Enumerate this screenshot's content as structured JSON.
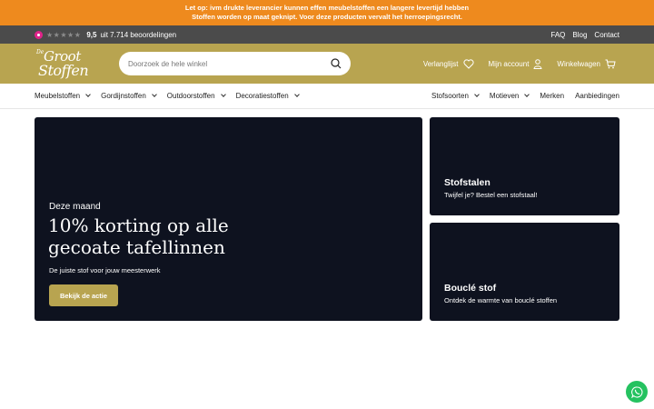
{
  "announcement": {
    "line1": "Let op: ivm drukte leverancier kunnen effen meubelstoffen een langere levertijd hebben",
    "line2": "Stoffen worden op maat geknipt. Voor deze producten vervalt het herroepingsrecht."
  },
  "topbar": {
    "stars": "★★★★★",
    "score": "9,5",
    "reviews": "uit 7.714 beoordelingen",
    "links": [
      "FAQ",
      "Blog",
      "Contact"
    ]
  },
  "header": {
    "logo": {
      "small": "De",
      "line1": "Groot",
      "line2": "Stoffen"
    },
    "search_placeholder": "Doorzoek de hele winkel",
    "wishlist": "Verlanglijst",
    "account": "Mijn account",
    "cart": "Winkelwagen"
  },
  "nav": {
    "left": [
      "Meubelstoffen",
      "Gordijnstoffen",
      "Outdoorstoffen",
      "Decoratiestoffen"
    ],
    "right": [
      {
        "label": "Stofsoorten",
        "dropdown": true
      },
      {
        "label": "Motieven",
        "dropdown": true
      },
      {
        "label": "Merken",
        "dropdown": false
      },
      {
        "label": "Aanbiedingen",
        "dropdown": false
      }
    ]
  },
  "hero": {
    "kicker": "Deze maand",
    "title": "10% korting op alle gecoate tafellinnen",
    "subtitle": "De juiste stof voor jouw meesterwerk",
    "button": "Bekijk de actie"
  },
  "cards": [
    {
      "title": "Stofstalen",
      "subtitle": "Twijfel je? Bestel een stofstaal!"
    },
    {
      "title": "Bouclé stof",
      "subtitle": "Ontdek de warmte van bouclé stoffen"
    }
  ],
  "colors": {
    "announcement_bg": "#ee8a1e",
    "topbar_bg": "#4b4b4b",
    "brand_gold": "#b8a450",
    "hero_bg": "#0e121f",
    "whatsapp_green": "#25c260"
  },
  "icons": {
    "search": "search-icon",
    "wishlist": "heart-icon",
    "account": "user-icon",
    "cart": "cart-icon",
    "whatsapp": "whatsapp-icon"
  }
}
